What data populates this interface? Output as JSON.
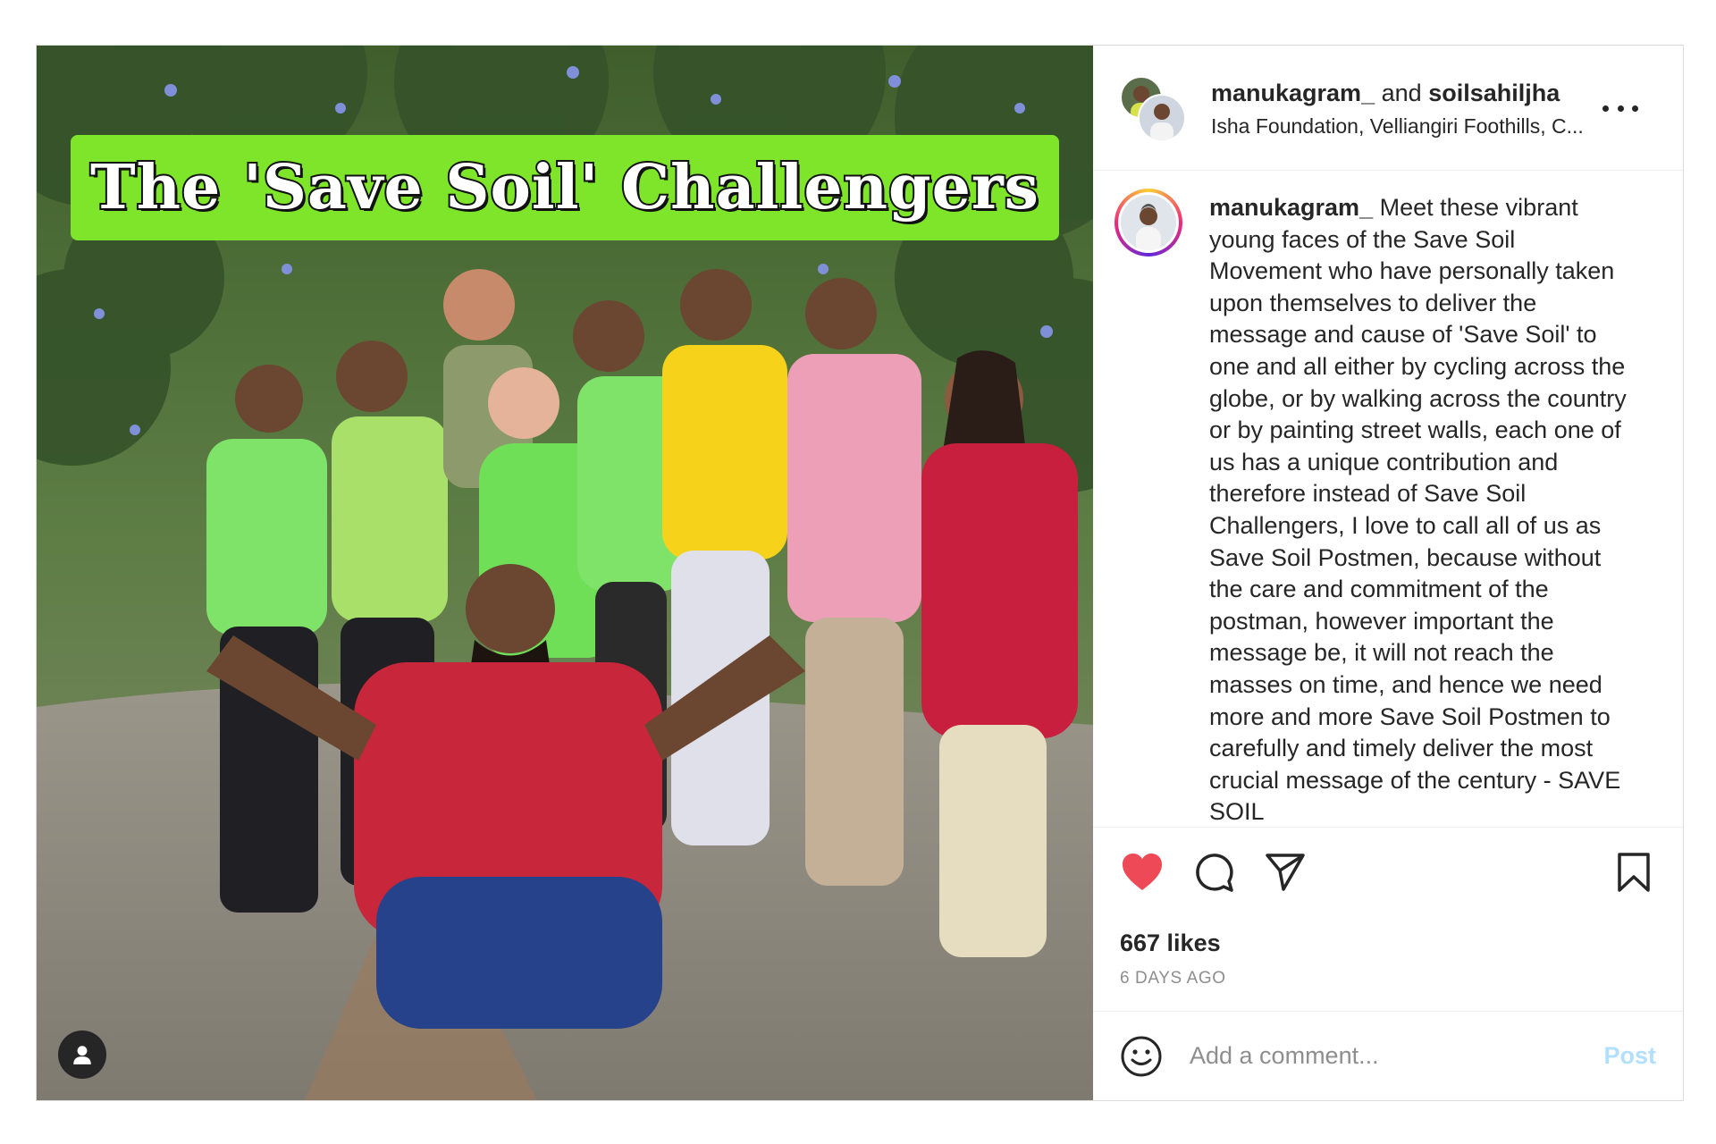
{
  "media": {
    "banner_text": "The 'Save Soil' Challengers",
    "banner_color": "#7ee52a",
    "tag_icon": "user-tag-icon"
  },
  "header": {
    "user1": "manukagram_",
    "joiner": "and",
    "user2": "soilsahiljha",
    "location": "Isha Foundation, Velliangiri Foothills, C..."
  },
  "caption": {
    "username": "manukagram_",
    "text": "Meet these vibrant young faces of the Save Soil Movement who have personally taken upon themselves to deliver the message and cause of 'Save Soil' to one and all either by cycling across the globe, or by walking across the country or by painting street walls, each one of us has a unique contribution and therefore instead of Save Soil Challengers, I love to call all of us as Save Soil Postmen, because without the care and commitment of the postman, however important the message be, it will not reach the masses on time, and hence we need more and more Save Soil Postmen to carefully and timely deliver the most crucial message of the century - SAVE SOIL"
  },
  "actions": {
    "like_color": "#ed4956",
    "likes": "667 likes",
    "time_ago": "6 DAYS AGO"
  },
  "comment": {
    "placeholder": "Add a comment...",
    "post_label": "Post"
  }
}
